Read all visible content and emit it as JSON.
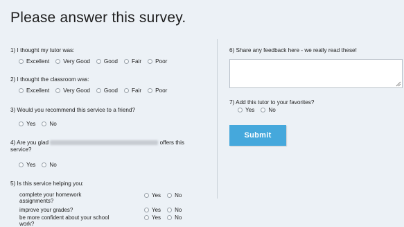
{
  "title": "Please answer this survey.",
  "q1": {
    "label": "1) I thought my tutor was:",
    "options": [
      "Excellent",
      "Very Good",
      "Good",
      "Fair",
      "Poor"
    ]
  },
  "q2": {
    "label": "2) I thought the classroom was:",
    "options": [
      "Excellent",
      "Very Good",
      "Good",
      "Fair",
      "Poor"
    ]
  },
  "q3": {
    "label": "3) Would you recommend this service to a friend?",
    "options": [
      "Yes",
      "No"
    ]
  },
  "q4": {
    "label_start": "4) Are you glad",
    "label_end": "offers this",
    "label_line2": "service?",
    "options": [
      "Yes",
      "No"
    ]
  },
  "q5": {
    "label": "5) Is this service helping you:",
    "rows": [
      {
        "line1": "complete your homework",
        "line2": "assignments?",
        "yes": "Yes",
        "no": "No"
      },
      {
        "line1": "improve your grades?",
        "line2": "",
        "yes": "Yes",
        "no": "No"
      },
      {
        "line1": "be more confident about your school",
        "line2": "work?",
        "yes": "Yes",
        "no": "No"
      }
    ]
  },
  "q6": {
    "label": "6) Share any feedback here - we really read these!",
    "value": ""
  },
  "q7": {
    "label": "7) Add this tutor to your favorites?",
    "options": [
      "Yes",
      "No"
    ]
  },
  "submit_label": "Submit"
}
